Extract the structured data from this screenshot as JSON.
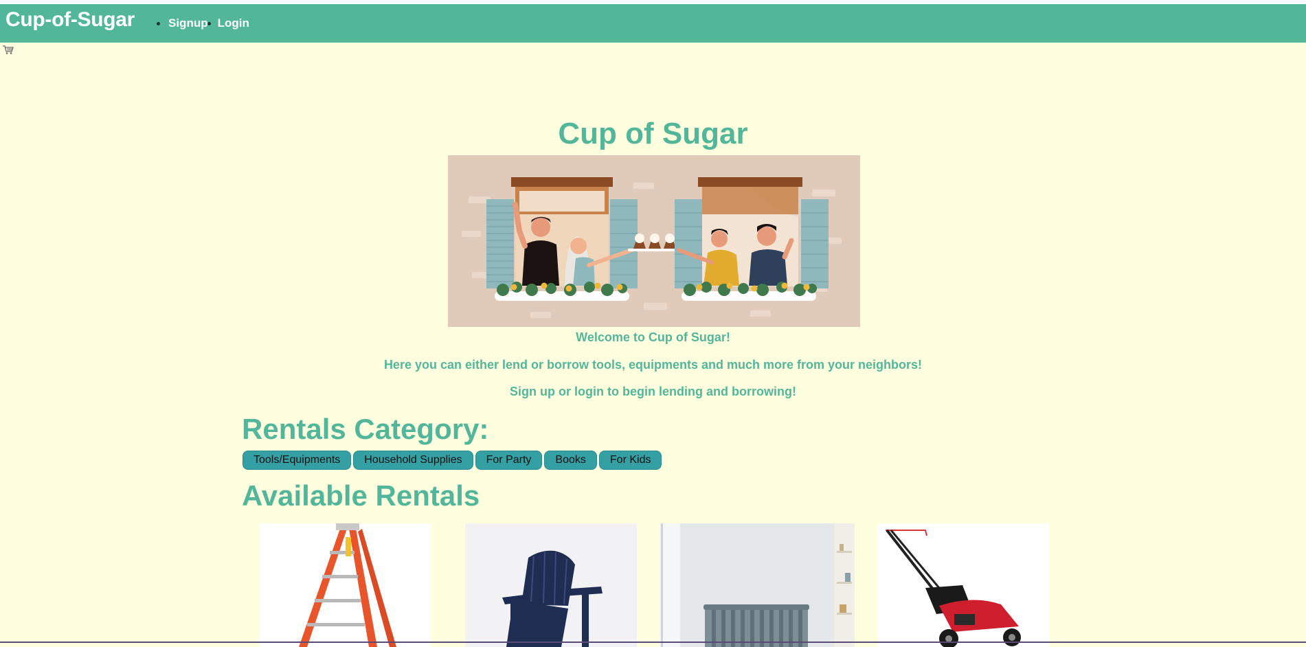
{
  "navbar": {
    "brand": "Cup-of-Sugar",
    "links": [
      {
        "label": "Signup"
      },
      {
        "label": "Login"
      }
    ]
  },
  "hero": {
    "title": "Cup of Sugar",
    "welcome": "Welcome to Cup of Sugar!",
    "description": "Here you can either lend or borrow tools, equipments and much more from your neighbors!",
    "cta": "Sign up or login to begin lending and borrowing!"
  },
  "categories": {
    "title": "Rentals Category:",
    "buttons": [
      "Tools/Equipments",
      "Household Supplies",
      "For Party",
      "Books",
      "For Kids"
    ]
  },
  "rentals": {
    "title": "Available Rentals",
    "items": [
      {
        "icon": "ladder"
      },
      {
        "icon": "adirondack-chair"
      },
      {
        "icon": "crib"
      },
      {
        "icon": "lawn-mower"
      }
    ]
  },
  "colors": {
    "background": "#ffffe0",
    "navbar": "#52b69a",
    "accent": "#52b69a",
    "button": "#34a0a4"
  }
}
